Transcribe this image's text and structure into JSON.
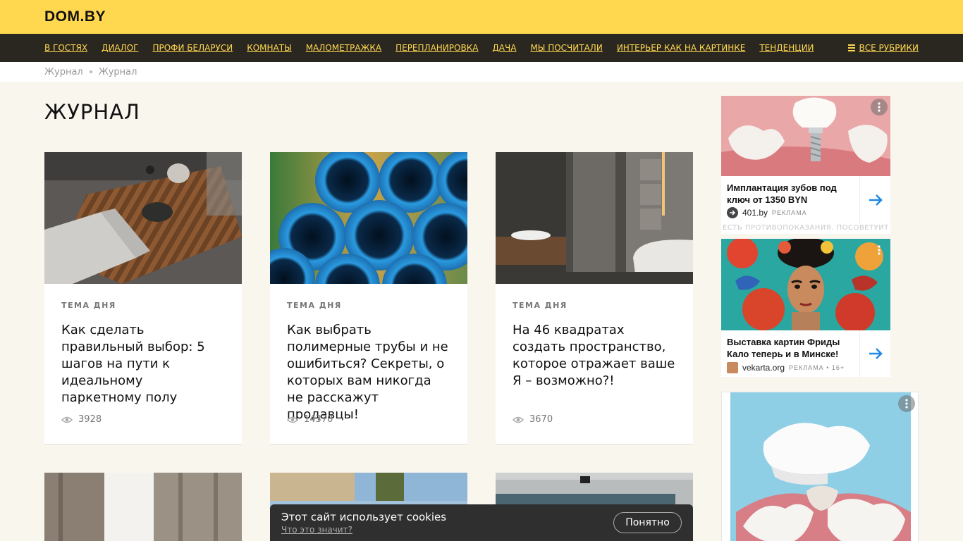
{
  "header": {
    "logo": "DOM.BY",
    "nav": [
      {
        "label": "В гостях"
      },
      {
        "label": "Диалог"
      },
      {
        "label": "Профи Беларуси"
      },
      {
        "label": "Комнаты"
      },
      {
        "label": "Малометражка"
      },
      {
        "label": "Перепланировка"
      },
      {
        "label": "Дача"
      },
      {
        "label": "Мы посчитали"
      },
      {
        "label": "Интерьер как на картинке"
      },
      {
        "label": "Тенденции"
      }
    ],
    "all_rubrics": "Все рубрики",
    "colors": {
      "accent": "#ffd84f",
      "navbar": "#2a2620"
    }
  },
  "breadcrumb": [
    "Журнал",
    "Журнал"
  ],
  "page_title": "ЖУРНАЛ",
  "cards": [
    {
      "tag": "Тема дня",
      "title": "Как сделать правильный выбор: 5 шагов на пути к идеальному паркетному полу",
      "views": "3928",
      "image": "living-room-photo"
    },
    {
      "tag": "Тема дня",
      "title": "Как выбрать полимерные трубы и не ошибиться? Секреты, о которых вам никогда не расскажут продавцы!",
      "views": "14370",
      "image": "blue-pipes-photo"
    },
    {
      "tag": "Тема дня",
      "title": "На 46 квадратах создать пространство, которое отражает ваше Я – возможно?!",
      "views": "3670",
      "image": "bathroom-photo"
    }
  ],
  "ads": [
    {
      "title": "Имплантация зубов под ключ от 1350 BYN",
      "source": "401.by",
      "label": "РЕКЛАМА",
      "disclaimer": "ЕСТЬ ПРОТИВОПОКАЗАНИЯ. ПОСОВЕТУЙТЕСЬ С ВРАЧОМ",
      "image": "dental-implant-image"
    },
    {
      "title": "Выставка картин Фриды Кало теперь и в Минске!",
      "source": "vekarta.org",
      "label": "РЕКЛАМА • 16+",
      "image": "frida-painting-image"
    }
  ],
  "cookie": {
    "message": "Этот сайт использует cookies",
    "link": "Что это значит?",
    "button": "Понятно"
  }
}
